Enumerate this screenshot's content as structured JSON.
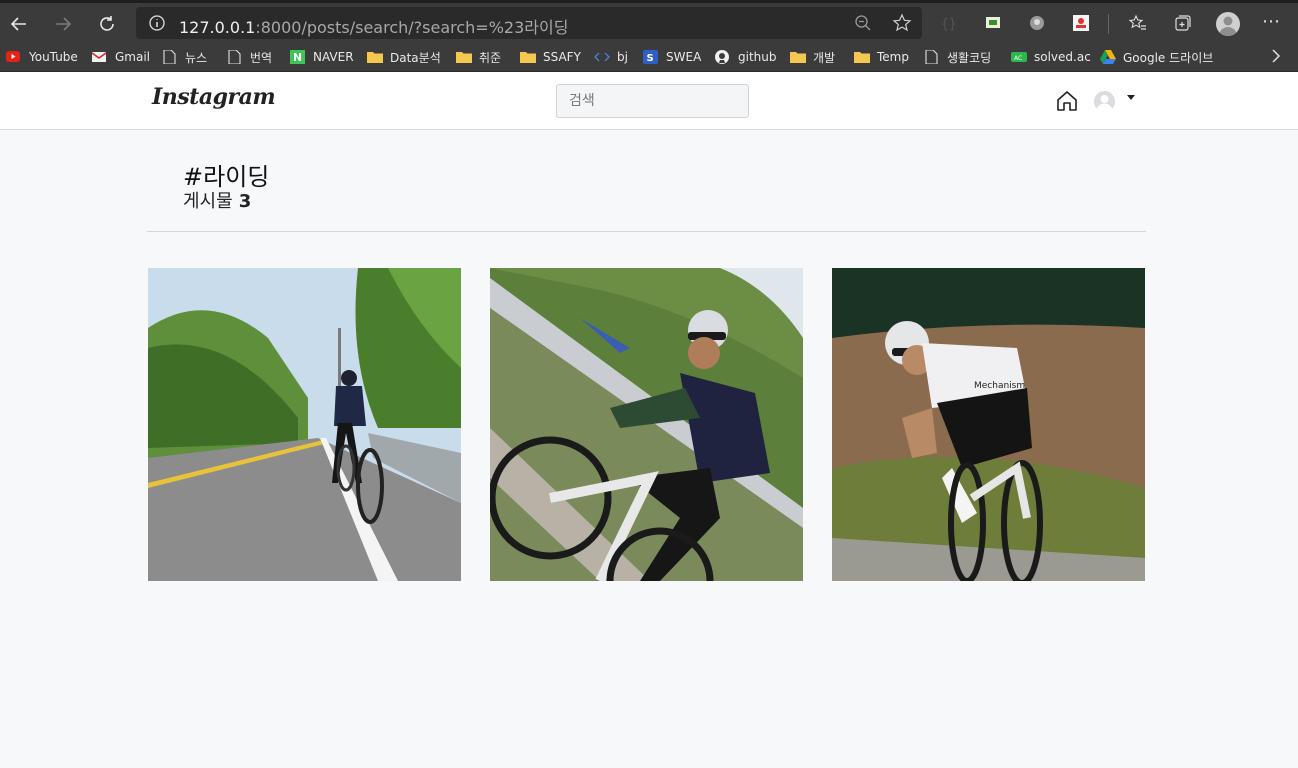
{
  "browser": {
    "url_host": "127.0.0.1",
    "url_rest": ":8000/posts/search/?search=%23라이딩",
    "bookmarks": [
      {
        "label": "YouTube",
        "icon": "youtube-icon"
      },
      {
        "label": "Gmail",
        "icon": "gmail-icon"
      },
      {
        "label": "뉴스",
        "icon": "page-icon"
      },
      {
        "label": "번역",
        "icon": "page-icon"
      },
      {
        "label": "NAVER",
        "icon": "naver-icon"
      },
      {
        "label": "Data분석",
        "icon": "folder-icon"
      },
      {
        "label": "취준",
        "icon": "folder-icon"
      },
      {
        "label": "SSAFY",
        "icon": "folder-icon"
      },
      {
        "label": "bj",
        "icon": "code-icon"
      },
      {
        "label": "SWEA",
        "icon": "swea-icon"
      },
      {
        "label": "github",
        "icon": "github-icon"
      },
      {
        "label": "개발",
        "icon": "folder-icon"
      },
      {
        "label": "Temp",
        "icon": "folder-icon"
      },
      {
        "label": "생활코딩",
        "icon": "page-icon"
      },
      {
        "label": "solved.ac",
        "icon": "solvedac-icon"
      },
      {
        "label": "Google 드라이브",
        "icon": "google-drive-icon"
      }
    ]
  },
  "app": {
    "logo": "Instagram",
    "search_placeholder": "검색"
  },
  "search_result": {
    "tag": "#라이딩",
    "count_label": "게시물",
    "count": "3"
  },
  "posts": [
    {
      "description": "cyclist-road-photo"
    },
    {
      "description": "cyclist-hill-photo"
    },
    {
      "description": "cyclist-turn-photo"
    }
  ]
}
